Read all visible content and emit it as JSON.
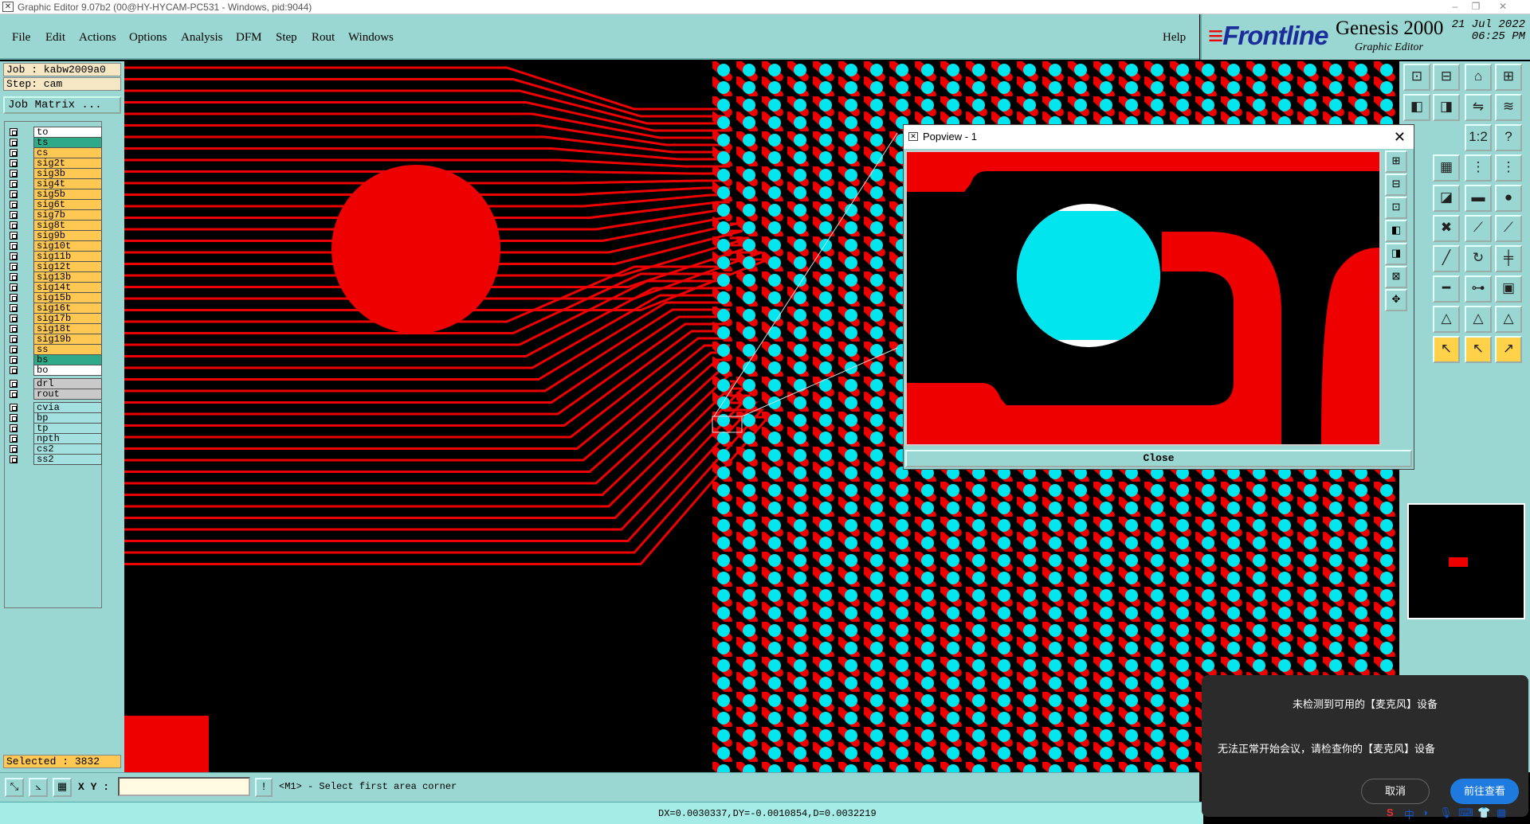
{
  "window": {
    "title": "Graphic Editor 9.07b2 (00@HY-HYCAM-PC531 - Windows, pid:9044)"
  },
  "menu": [
    "File",
    "Edit",
    "Actions",
    "Options",
    "Analysis",
    "DFM",
    "Step",
    "Rout",
    "Windows"
  ],
  "help_label": "Help",
  "brand": {
    "logo": "Frontline",
    "product": "Genesis 2000",
    "subtitle": "Graphic Editor",
    "date": "21 Jul 2022",
    "time": "06:25 PM"
  },
  "info": {
    "job": "Job : kabw2009a0",
    "step": "Step: cam",
    "job_matrix": "Job Matrix ..."
  },
  "layers": [
    {
      "name": "to",
      "color": "white"
    },
    {
      "name": "ts",
      "color": "teal"
    },
    {
      "name": "cs",
      "color": "orange"
    },
    {
      "name": "sig2t",
      "color": "orange"
    },
    {
      "name": "sig3b",
      "color": "orange"
    },
    {
      "name": "sig4t",
      "color": "orange"
    },
    {
      "name": "sig5b",
      "color": "orange"
    },
    {
      "name": "sig6t",
      "color": "orange"
    },
    {
      "name": "sig7b",
      "color": "orange"
    },
    {
      "name": "sig8t",
      "color": "orange"
    },
    {
      "name": "sig9b",
      "color": "orange"
    },
    {
      "name": "sig10t",
      "color": "orange"
    },
    {
      "name": "sig11b",
      "color": "orange"
    },
    {
      "name": "sig12t",
      "color": "orange"
    },
    {
      "name": "sig13b",
      "color": "orange"
    },
    {
      "name": "sig14t",
      "color": "orange"
    },
    {
      "name": "sig15b",
      "color": "orange"
    },
    {
      "name": "sig16t",
      "color": "orange"
    },
    {
      "name": "sig17b",
      "color": "orange"
    },
    {
      "name": "sig18t",
      "color": "orange"
    },
    {
      "name": "sig19b",
      "color": "orange"
    },
    {
      "name": "ss",
      "color": "orange"
    },
    {
      "name": "bs",
      "color": "teal"
    },
    {
      "name": "bo",
      "color": "white"
    },
    {
      "name": "drl",
      "color": "grey"
    },
    {
      "name": "rout",
      "color": "grey"
    },
    {
      "name": "cvia",
      "color": "lblue"
    },
    {
      "name": "bp",
      "color": "lblue"
    },
    {
      "name": "tp",
      "color": "lblue"
    },
    {
      "name": "npth",
      "color": "lblue"
    },
    {
      "name": "cs2",
      "color": "lblue"
    },
    {
      "name": "ss2",
      "color": "lblue"
    }
  ],
  "selected": "Selected : 3832",
  "status": {
    "xy_label": "X Y :",
    "xy_value": "",
    "message": "<M1> - Select first area corner",
    "measure": "DX=0.0030337,DY=-0.0010854,D=0.0032219"
  },
  "popview": {
    "title": "Popview - 1",
    "close_label": "Close"
  },
  "toast": {
    "title": "未检测到可用的【麦克风】设备",
    "body": "无法正常开始会议，请检查你的【麦克风】设备",
    "cancel": "取消",
    "go": "前往查看"
  },
  "tray": {
    "ime": "中"
  },
  "colors": {
    "copper": "#e00000",
    "pad": "#00e5ee",
    "panel": "#9ad7d2",
    "layer_signal": "#ffc853",
    "layer_mask": "#2eaa88"
  }
}
